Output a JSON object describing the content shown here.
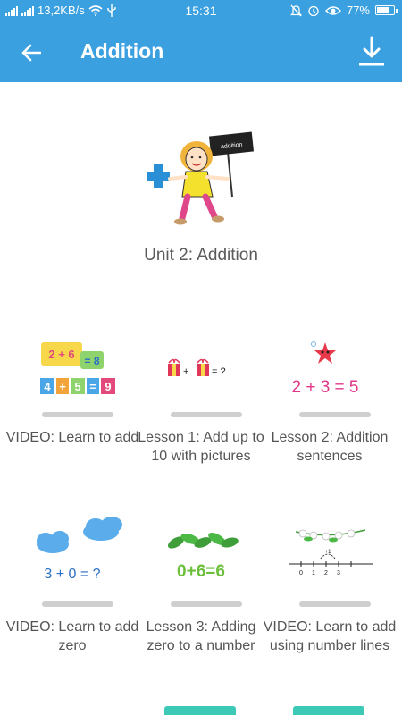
{
  "status_bar": {
    "net_speed": "13,2KB/s",
    "time": "15:31",
    "battery": "77%",
    "battery_level": 0.77
  },
  "app_bar": {
    "title": "Addition",
    "back_icon": "arrow-left-icon",
    "download_icon": "download-icon"
  },
  "unit": {
    "title": "Unit 2: Addition",
    "sign_text": "addition"
  },
  "lessons": [
    {
      "label": "VIDEO: Learn to add",
      "thumb": {
        "top": [
          "2 + 6",
          "= 8"
        ],
        "bottom": [
          "4",
          "+",
          "5",
          "=",
          "9"
        ]
      }
    },
    {
      "label": "Lesson 1: Add up to 10 with pictures",
      "thumb": {
        "text": "+ = ?"
      }
    },
    {
      "label": "Lesson 2: Addition sentences",
      "thumb": {
        "text": "2 + 3 = 5"
      }
    },
    {
      "label": "VIDEO: Learn to add zero",
      "thumb": {
        "text": "3 + 0 = ?"
      }
    },
    {
      "label": "Lesson 3: Adding zero to a number",
      "thumb": {
        "text": "0+6=6"
      }
    },
    {
      "label": "VIDEO: Learn to add using number lines",
      "thumb": {
        "numbers": [
          "0",
          "1",
          "2",
          "3"
        ],
        "arc": "+1"
      }
    }
  ],
  "colors": {
    "primary": "#3aa0e0",
    "progress_track": "#cfcfcf",
    "teal_accent": "#3cc9b5"
  }
}
